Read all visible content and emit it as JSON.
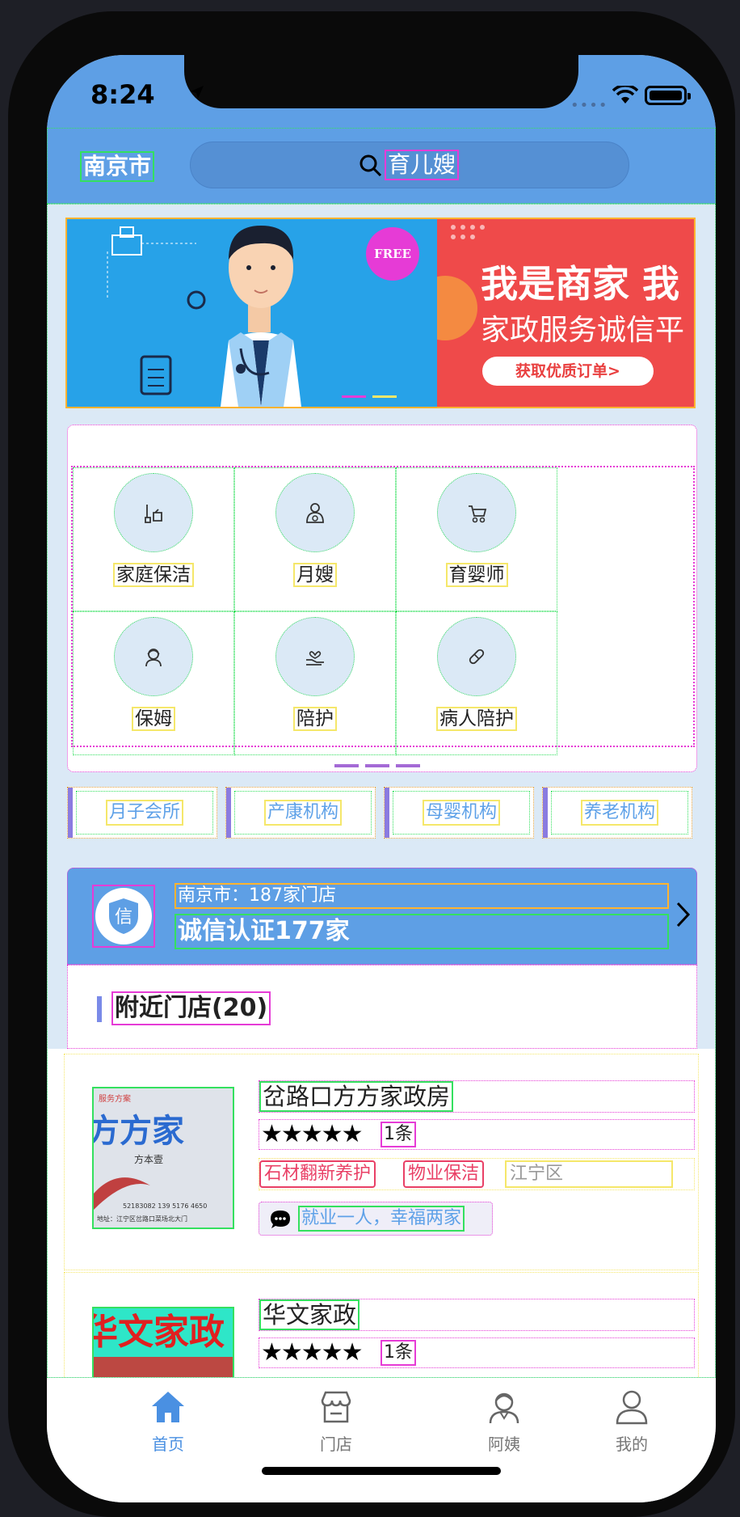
{
  "status_bar": {
    "time": "8:24"
  },
  "header": {
    "city": "南京市",
    "search_text": "育儿嫂"
  },
  "banner": {
    "free_badge": "FREE",
    "merchant_title": "我是商家 我",
    "merchant_subtitle": "家政服务诚信平",
    "merchant_button": "获取优质订单>"
  },
  "services": [
    {
      "label": "家庭保洁",
      "icon": "cleaning-icon"
    },
    {
      "label": "月嫂",
      "icon": "maternity-icon"
    },
    {
      "label": "育婴师",
      "icon": "stroller-icon"
    },
    {
      "label": "保姆",
      "icon": "nanny-icon"
    },
    {
      "label": "陪护",
      "icon": "care-hand-icon"
    },
    {
      "label": "病人陪护",
      "icon": "pill-icon"
    }
  ],
  "categories": [
    "月子会所",
    "产康机构",
    "母婴机构",
    "养老机构"
  ],
  "certification": {
    "badge": "信",
    "line1": "南京市：187家门店",
    "line2": "诚信认证177家"
  },
  "nearby": {
    "title": "附近门店(20)"
  },
  "shops": [
    {
      "name": "岔路口方方家政房",
      "stars": "★★★★★",
      "rating_count": "1条",
      "tags": [
        "石材翻新养护",
        "物业保洁"
      ],
      "district": "江宁区",
      "slogan": "就业一人，幸福两家",
      "image_text": "方方家",
      "image_sub": "方本壹",
      "image_phone": "52183082 139 5176 4650",
      "image_addr": "地址：江宁区岔路口菜场北大门",
      "image_top": "服务方案"
    },
    {
      "name": "华文家政",
      "stars": "★★★★★",
      "rating_count": "1条",
      "image_text": "华文家政"
    }
  ],
  "tabbar": [
    {
      "label": "首页",
      "icon": "home-icon",
      "active": true
    },
    {
      "label": "门店",
      "icon": "store-icon",
      "active": false
    },
    {
      "label": "阿姨",
      "icon": "nanny-avatar-icon",
      "active": false
    },
    {
      "label": "我的",
      "icon": "profile-icon",
      "active": false
    }
  ],
  "colors": {
    "primary": "#5e9fe5",
    "accent_pink": "#e94066",
    "accent_blue": "#5ea1e8",
    "background": "#dbe9f6"
  }
}
